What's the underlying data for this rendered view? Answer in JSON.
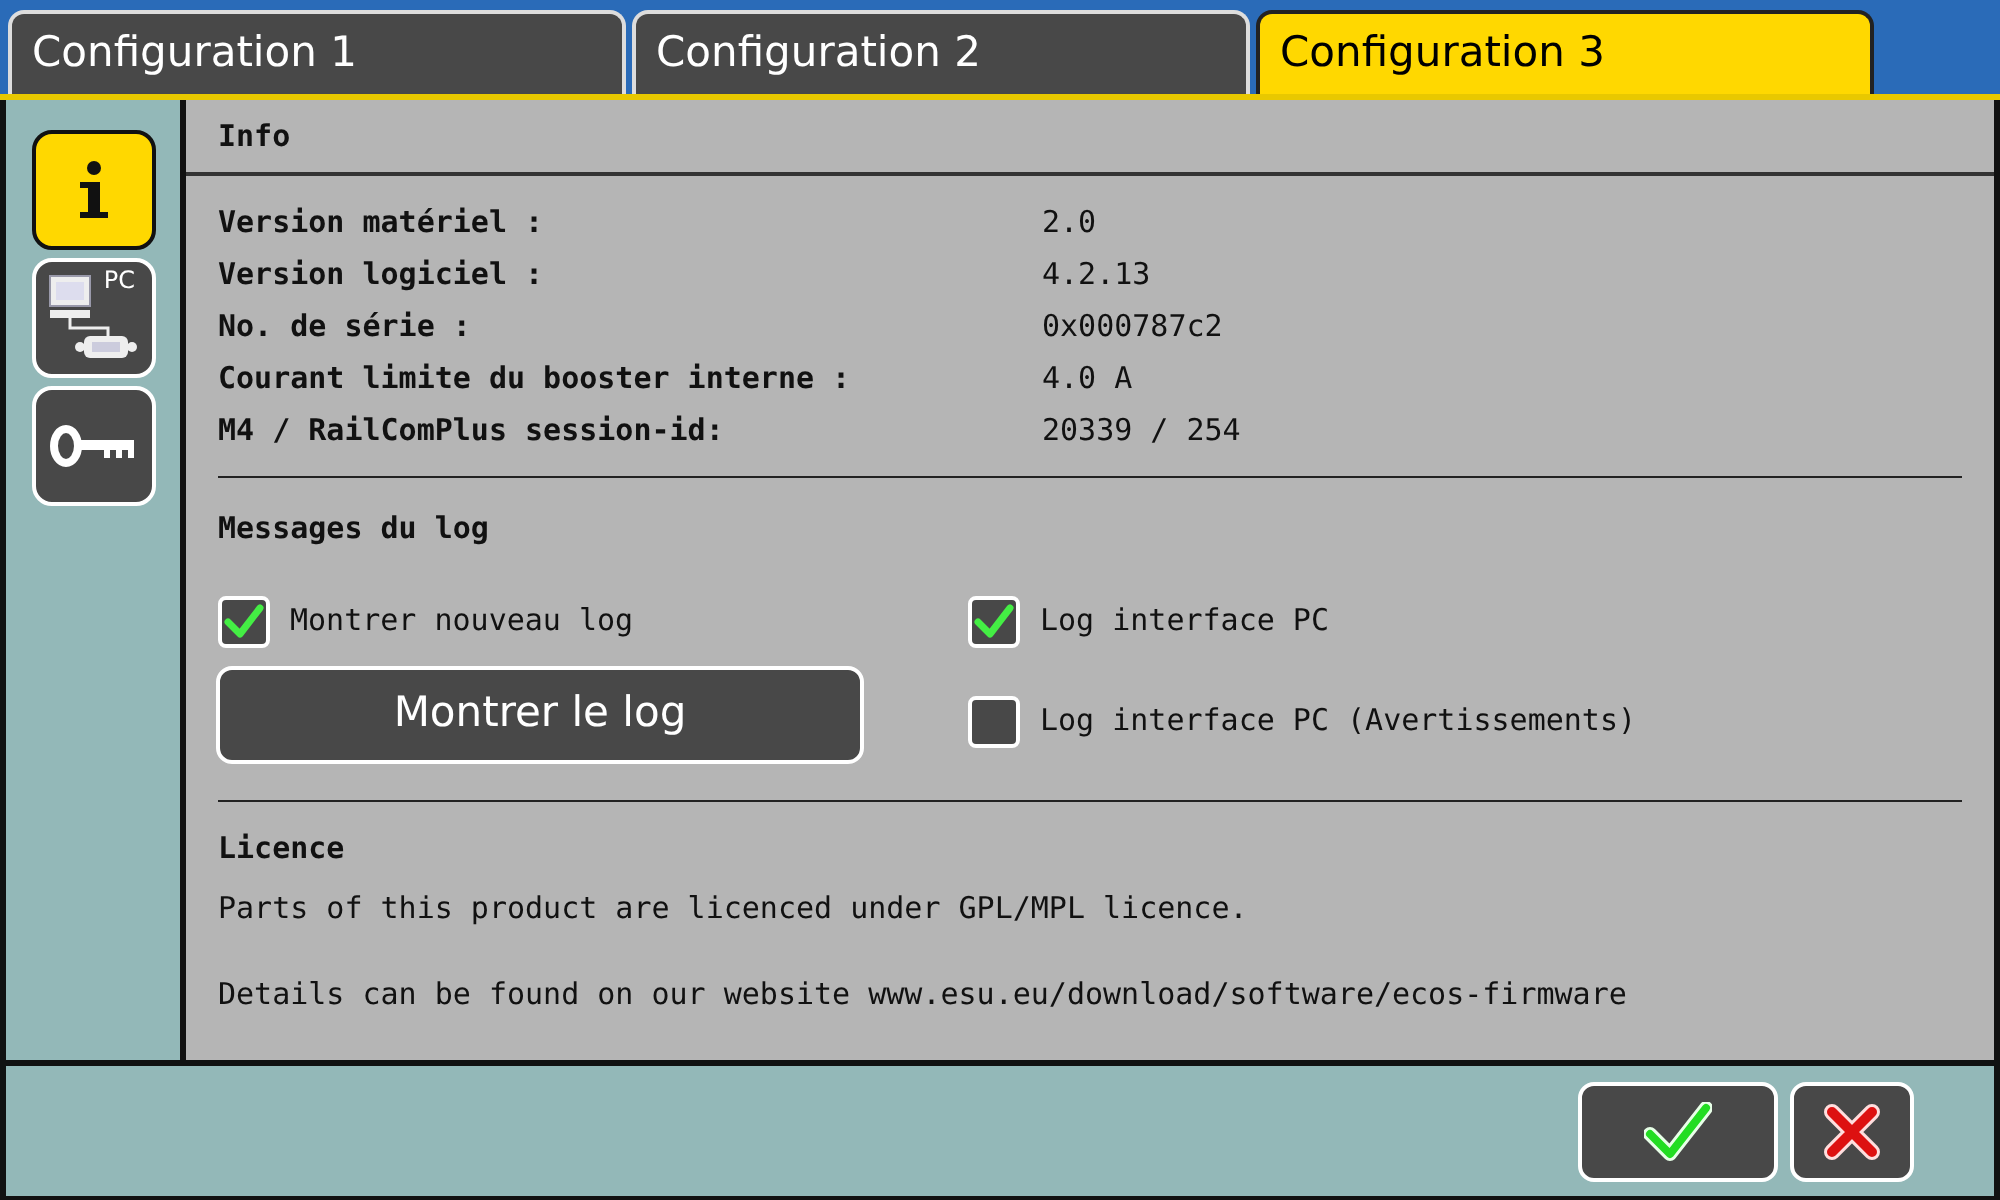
{
  "tabs": [
    {
      "label": "Configuration 1",
      "selected": false
    },
    {
      "label": "Configuration 2",
      "selected": false
    },
    {
      "label": "Configuration 3",
      "selected": true
    }
  ],
  "sidebar": {
    "items": [
      {
        "kind": "info",
        "selected": true
      },
      {
        "kind": "pc",
        "label": "PC",
        "selected": false
      },
      {
        "kind": "key",
        "selected": false
      }
    ]
  },
  "info": {
    "title": "Info",
    "rows": [
      {
        "label": "Version matériel :",
        "value": "2.0"
      },
      {
        "label": "Version logiciel :",
        "value": "4.2.13"
      },
      {
        "label": "No. de série :",
        "value": "0x000787c2"
      },
      {
        "label": "Courant limite du booster interne :",
        "value": "4.0 A"
      },
      {
        "label": "M4 / RailComPlus session-id:",
        "value": "20339 / 254"
      }
    ]
  },
  "log": {
    "title": "Messages du log",
    "options": [
      {
        "label": "Montrer nouveau log",
        "checked": true
      },
      {
        "label": "Log interface PC",
        "checked": true
      },
      {
        "label": "Log interface PC (Avertissements)",
        "checked": false
      }
    ],
    "button": "Montrer le log"
  },
  "licence": {
    "title": "Licence",
    "lines": [
      "Parts of this product are licenced under GPL/MPL licence.",
      "Details can be found on our website www.esu.eu/download/software/ecos-firmware"
    ]
  }
}
